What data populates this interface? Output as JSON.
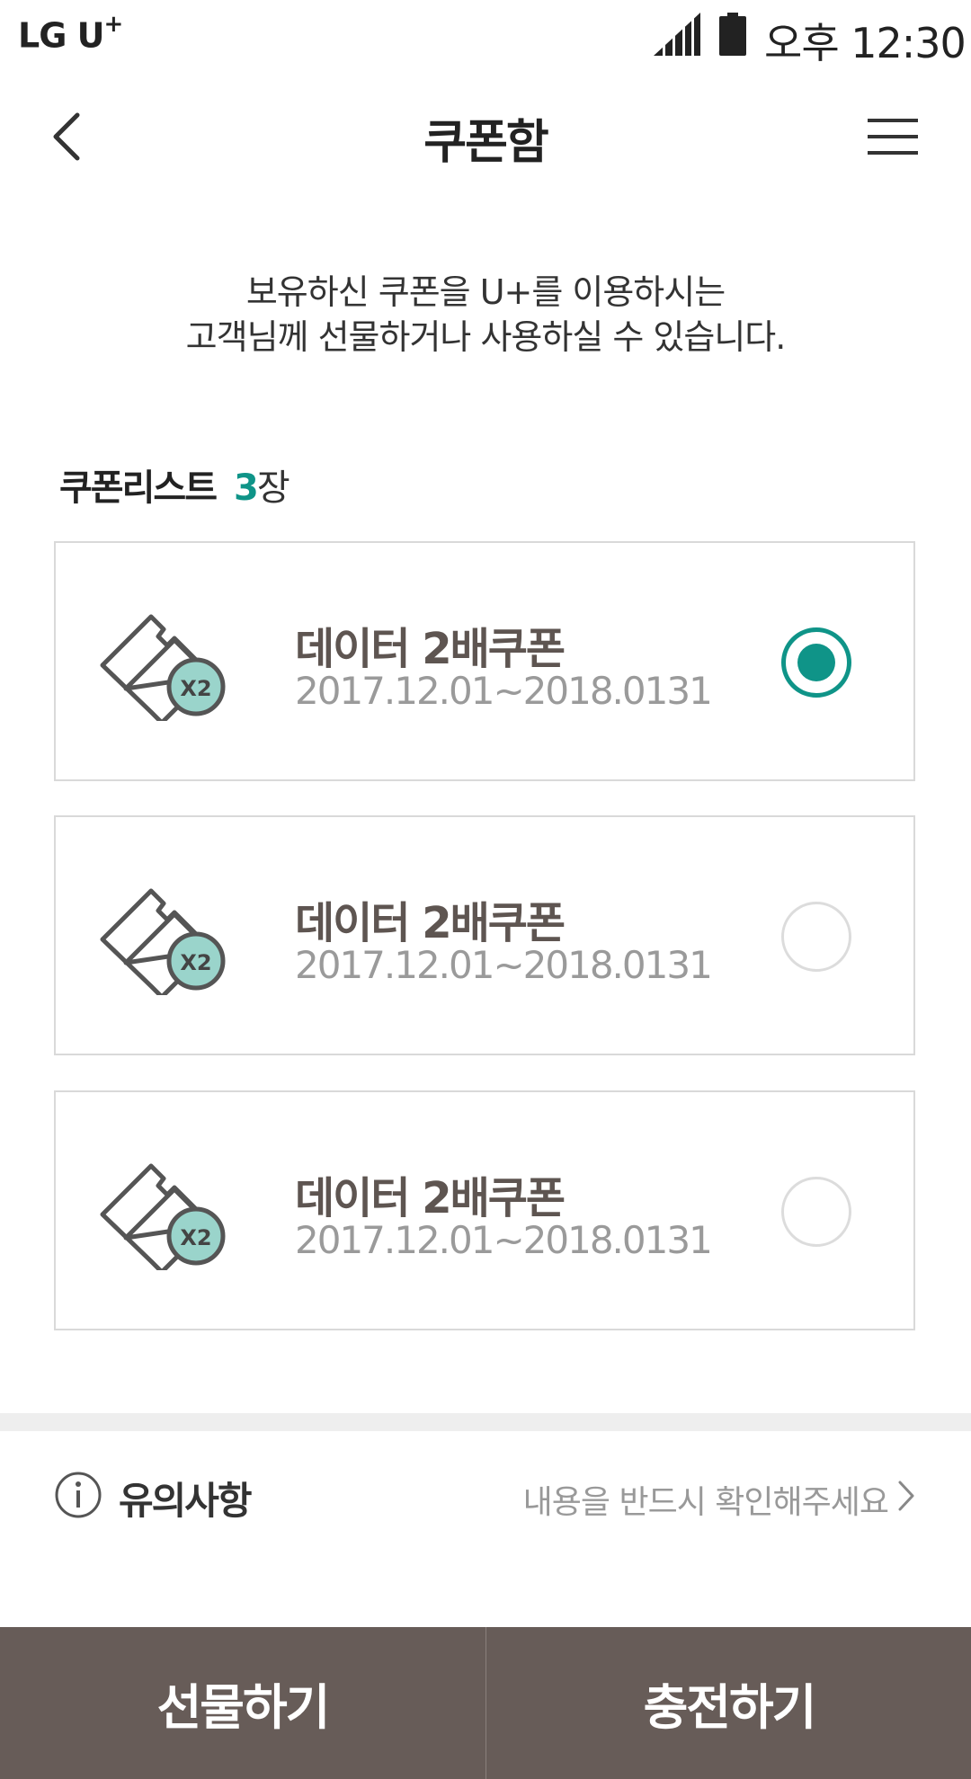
{
  "status_bar": {
    "carrier": "LG U",
    "carrier_sup": "+",
    "time": "오후 12:30"
  },
  "header": {
    "title": "쿠폰함",
    "back_icon": "chevron-left-icon",
    "menu_icon": "hamburger-menu-icon"
  },
  "intro": {
    "line1": "보유하신 쿠폰을 U+를 이용하시는",
    "line2": "고객님께 선물하거나 사용하실 수 있습니다."
  },
  "coupon_list": {
    "heading": "쿠폰리스트",
    "count": "3",
    "unit": "장",
    "items": [
      {
        "name": "데이터 2배쿠폰",
        "period": "2017.12.01~2018.0131",
        "icon_badge": "X2",
        "selected": true
      },
      {
        "name": "데이터 2배쿠폰",
        "period": "2017.12.01~2018.0131",
        "icon_badge": "X2",
        "selected": false
      },
      {
        "name": "데이터 2배쿠폰",
        "period": "2017.12.01~2018.0131",
        "icon_badge": "X2",
        "selected": false
      }
    ]
  },
  "notice": {
    "title": "유의사항",
    "link": "내용을 반드시 확인해주세요",
    "icon": "info-icon"
  },
  "actions": {
    "gift": "선물하기",
    "charge": "충전하기"
  },
  "colors": {
    "accent": "#0f9488",
    "bottom_bar": "#675c58",
    "badge": "#9ad4cb"
  }
}
